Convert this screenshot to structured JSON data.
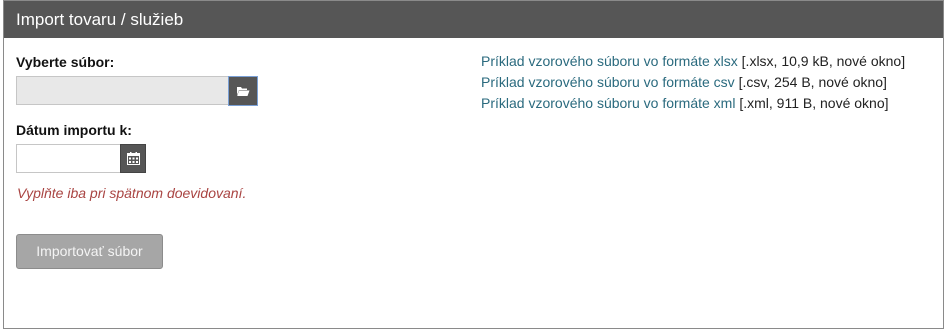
{
  "header": {
    "title": "Import tovaru / služieb"
  },
  "form": {
    "file_label": "Vyberte súbor:",
    "file_value": "",
    "date_label": "Dátum importu k:",
    "date_value": "",
    "hint": "Vyplňte iba pri spätnom doevidovaní.",
    "import_button": "Importovať súbor"
  },
  "icons": {
    "file_browse": "folder-open-icon",
    "date_picker": "calendar-icon"
  },
  "samples": [
    {
      "link": "Príklad vzorového súboru vo formáte xlsx",
      "meta": "[.xlsx, 10,9 kB, nové okno]"
    },
    {
      "link": "Príklad vzorového súboru vo formáte csv",
      "meta": "[.csv, 254 B, nové okno]"
    },
    {
      "link": "Príklad vzorového súboru vo formáte xml",
      "meta": "[.xml, 911 B, nové okno]"
    }
  ],
  "colors": {
    "header_bg": "#565656",
    "link": "#2a6a7e",
    "hint": "#a94442",
    "button_disabled": "#a6a6a6"
  }
}
